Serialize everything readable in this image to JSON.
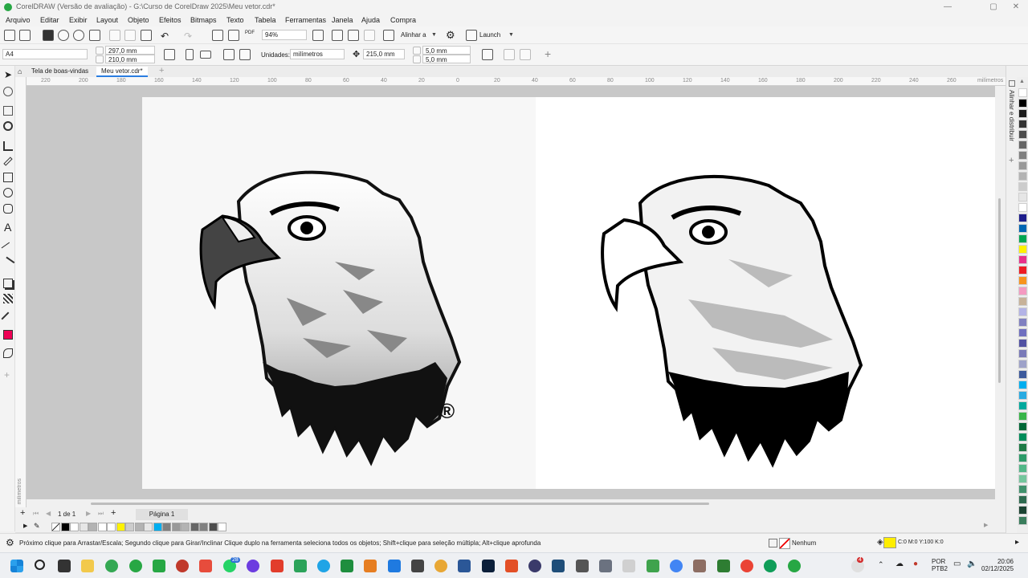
{
  "window": {
    "title": "CorelDRAW (Versão de avaliação) - G:\\Curso de CorelDraw 2025\\Meu vetor.cdr*",
    "controls": [
      "—",
      "▢",
      "✕"
    ]
  },
  "menu": [
    "Arquivo",
    "Editar",
    "Exibir",
    "Layout",
    "Objeto",
    "Efeitos",
    "Bitmaps",
    "Texto",
    "Tabela",
    "Ferramentas",
    "Janela",
    "Ajuda",
    "Compra"
  ],
  "toolbar": {
    "zoom_value": "94%",
    "align_label": "Alinhar a",
    "launch_label": "Launch"
  },
  "propbar": {
    "page_size": "A4",
    "width": "297,0 mm",
    "height": "210,0 mm",
    "units_label": "Unidades:",
    "units_value": "milímetros",
    "nudge": "215,0 mm",
    "dup_x": "5,0 mm",
    "dup_y": "5,0 mm"
  },
  "tabs": {
    "welcome": "Tela de boas-vindas",
    "document": "Meu vetor.cdr*"
  },
  "ruler": {
    "unit": "milímetros",
    "h_ticks": [
      "220",
      "200",
      "180",
      "160",
      "140",
      "120",
      "100",
      "80",
      "60",
      "40",
      "20",
      "0",
      "20",
      "40",
      "60",
      "80",
      "100",
      "120",
      "140",
      "160",
      "180",
      "200",
      "220",
      "240",
      "260"
    ],
    "v_unit": "milímetros"
  },
  "canvas": {
    "registered_mark": "®"
  },
  "pagenav": {
    "counter": "1 de 1",
    "page_tab": "Página 1"
  },
  "docker": {
    "label": "Alinhar e distribuir"
  },
  "status": {
    "hint": "Próximo clique para Arrastar/Escala; Segundo clique para Girar/Inclinar Clique duplo na ferramenta seleciona todos os objetos; Shift+clique para seleção múltipla; Alt+clique aprofunda",
    "outline": "Nenhum",
    "fill": "C:0 M:0 Y:100 K:0",
    "fill_color": "#ffee00"
  },
  "taskbar": {
    "badge": "28",
    "notify_badge": "4",
    "lang": "POR",
    "layout": "PTB2",
    "time": "20:06",
    "date": "02/12/2025"
  },
  "palette_colors": [
    "#ffffff",
    "#000000",
    "#1a1a1a",
    "#333333",
    "#4d4d4d",
    "#666666",
    "#808080",
    "#999999",
    "#b3b3b3",
    "#cccccc",
    "#e6e6e6",
    "#ffffff",
    "#1e1e8c",
    "#0066b3",
    "#00a651",
    "#fff200",
    "#e8318a",
    "#ed1c24",
    "#f7941d",
    "#f49ac1",
    "#c7b299",
    "#b3b3e6",
    "#8080c0",
    "#6f6fbf",
    "#5252a3",
    "#7a7ab8",
    "#9ea2c9",
    "#3d5a9c",
    "#00aeef",
    "#29abe2",
    "#00a99d",
    "#39b54a",
    "#006837",
    "#008c5a",
    "#1e7a46",
    "#2d9b69",
    "#52b788",
    "#74c69d",
    "#40916c",
    "#2d6a4f",
    "#1b4332",
    "#3a7d5c"
  ],
  "doc_palette": [
    "transparent",
    "#000000",
    "#ffffff",
    "#e6e6e6",
    "#b3b3b3",
    "#ffffff",
    "#ffffff",
    "#fff200",
    "#cccccc",
    "#b3b3b3",
    "#e6e6e6",
    "#00aeef",
    "#808080",
    "#999999",
    "#b3b3b3",
    "#666666",
    "#808080",
    "#4d4d4d",
    "#ffffff"
  ]
}
